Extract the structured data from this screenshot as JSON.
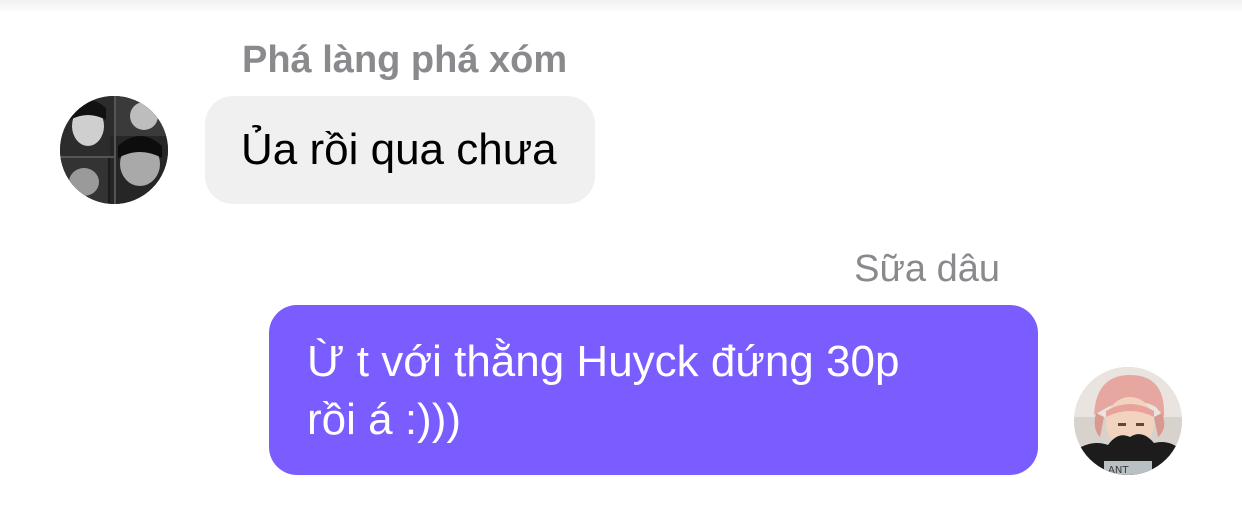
{
  "conversation": {
    "messages": [
      {
        "direction": "incoming",
        "sender": "Phá làng phá xóm",
        "lines": [
          "Ủa rồi qua chưa"
        ],
        "bubble_color": "#f0f0f0",
        "avatar": "monochrome-collage-avatar"
      },
      {
        "direction": "outgoing",
        "sender": "Sữa dâu",
        "lines": [
          "Ừ t với thằng Huyck đứng 30p",
          "rồi á :)))"
        ],
        "bubble_color": "#7b5cff",
        "avatar": "pink-hair-avatar"
      }
    ]
  },
  "colors": {
    "name_text": "#8a8a8e",
    "incoming_bubble": "#f0f0f0",
    "outgoing_bubble": "#7b5cff",
    "outgoing_text": "#ffffff",
    "background": "#ffffff"
  }
}
